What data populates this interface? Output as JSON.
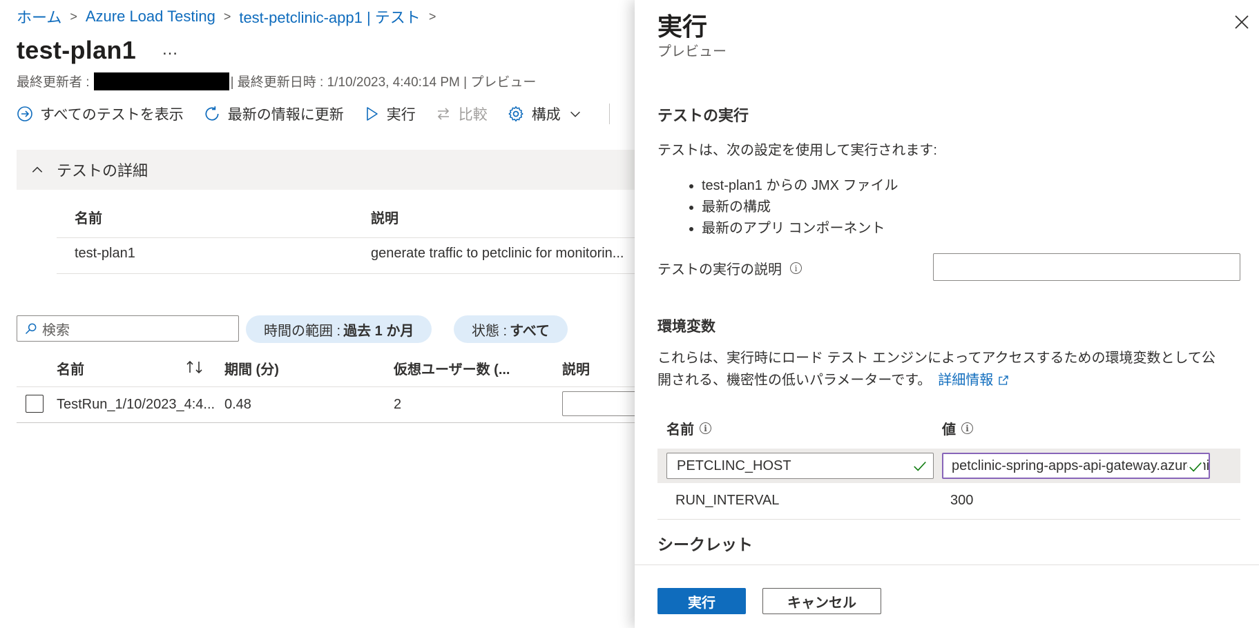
{
  "breadcrumb": {
    "items": [
      "ホーム",
      "Azure Load Testing",
      "test-petclinic-app1 | テスト"
    ]
  },
  "page": {
    "title": "test-plan1",
    "more_label": "…",
    "meta_prefix": "最終更新者 :",
    "meta_suffix": "| 最終更新日時 : 1/10/2023, 4:40:14 PM | プレビュー"
  },
  "toolbar": {
    "view_all": "すべてのテストを表示",
    "refresh": "最新の情報に更新",
    "run": "実行",
    "compare": "比較",
    "configure": "構成"
  },
  "details": {
    "header": "テストの詳細",
    "columns": [
      "名前",
      "説明"
    ],
    "row": {
      "name": "test-plan1",
      "description": "generate traffic to petclinic for monitorin..."
    }
  },
  "filters": {
    "search_placeholder": "検索",
    "time_range_label": "時間の範囲 :",
    "time_range_value": "過去 1 か月",
    "status_label": "状態 :",
    "status_value": "すべて"
  },
  "runs_table": {
    "columns": [
      "名前",
      "期間 (分)",
      "仮想ユーザー数 (...",
      "説明"
    ],
    "rows": [
      {
        "name": "TestRun_1/10/2023_4:4...",
        "duration": "0.48",
        "vusers": "2"
      }
    ]
  },
  "panel": {
    "title": "実行",
    "subtitle": "プレビュー",
    "section_run": "テストの実行",
    "run_intro": "テストは、次の設定を使用して実行されます:",
    "bullets": [
      "test-plan1 からの JMX ファイル",
      "最新の構成",
      "最新のアプリ コンポーネント"
    ],
    "run_description_label": "テストの実行の説明",
    "env_heading": "環境変数",
    "env_text_line1": "これらは、実行時にロード テスト エンジンによってアクセスするための環境変数として公",
    "env_text_line2": "開される、機密性の低いパラメーターです。",
    "learn_more": "詳細情報",
    "env_columns": {
      "name": "名前",
      "value": "値"
    },
    "env_rows": [
      {
        "name": "PETCLINC_HOST",
        "value": "petclinic-spring-apps-api-gateway.azuremicroservices.io"
      },
      {
        "name": "RUN_INTERVAL",
        "value": "300"
      }
    ],
    "secrets_heading": "シークレット",
    "primary_button": "実行",
    "cancel_button": "キャンセル"
  },
  "colors": {
    "accent": "#0f6cbd",
    "pill_bg": "#deecf9",
    "focus_border": "#8764b8",
    "check_green": "#107c10"
  }
}
